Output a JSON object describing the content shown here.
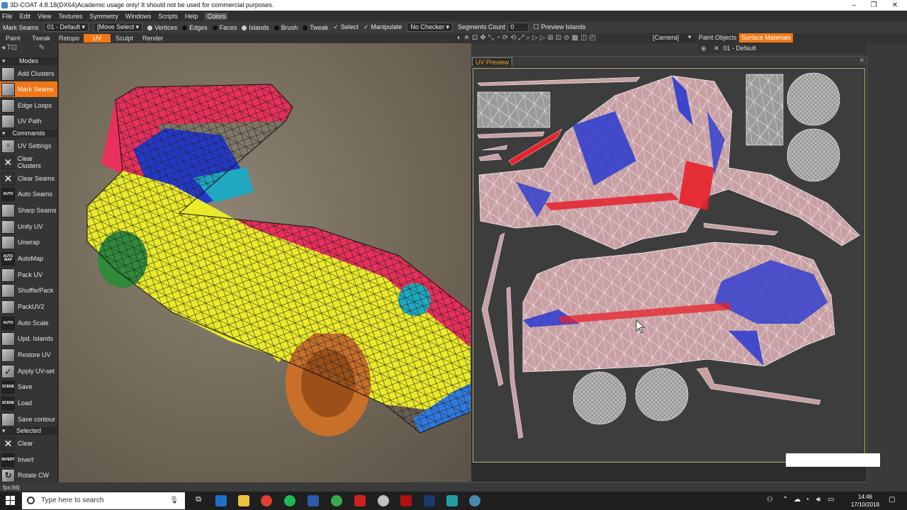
{
  "window": {
    "title": "3D-COAT 4.8.18(DX64)Academic usage only! It should not be used for commercial purposes.",
    "minimize_icon": "minimize-icon",
    "maximize_icon": "restore-icon",
    "close_icon": "close-icon"
  },
  "menu": [
    "File",
    "Edit",
    "View",
    "Textures",
    "Symmetry",
    "Windows",
    "Scripts",
    "Help",
    "Colors"
  ],
  "toolbar": {
    "current_tool": "Mark Seams",
    "object_select": "01 - Default",
    "move_select": "[Move Select",
    "modes": [
      "Vertices",
      "Edges",
      "Faces",
      "Islands",
      "Brush",
      "Tweak"
    ],
    "select_label": "Select",
    "manipulate_label": "Manipulate",
    "checker": "No Checker",
    "segments_label": "Segments Count",
    "segments_value": "0",
    "preview_islands": "Preview Islands"
  },
  "rooms": {
    "tabs": [
      "Paint",
      "Tweak",
      "Retopo",
      "UV",
      "Sculpt",
      "Render"
    ],
    "active": "UV",
    "camera": "[Camera]",
    "right_tabs": [
      "Paint Objects",
      "Surface Materials"
    ],
    "active_right": "Surface Materials",
    "material_item": "01 - Default"
  },
  "left_panel": {
    "sections": {
      "modes": "Modes",
      "commands": "Commands",
      "selected": "Selected"
    },
    "modes": [
      {
        "label": "Add Clusters",
        "icon": "add-clusters-icon"
      },
      {
        "label": "Mark Seams",
        "icon": "mark-seams-icon",
        "active": true
      },
      {
        "label": "Edge Loops",
        "icon": "edge-loops-icon"
      },
      {
        "label": "UV Path",
        "icon": "uv-path-icon"
      }
    ],
    "commands": [
      {
        "label": "UV Settings",
        "icon": "settings-icon"
      },
      {
        "label": "Clear Clusters",
        "icon": "x-icon"
      },
      {
        "label": "Clear Seams",
        "icon": "x-icon"
      },
      {
        "label": "Auto Seams",
        "icon_text": "AUTO"
      },
      {
        "label": "Sharp Seams",
        "icon": "sharp-seams-icon"
      },
      {
        "label": "Unify UV",
        "icon": "unify-uv-icon"
      },
      {
        "label": "Unwrap",
        "icon": "unwrap-icon"
      },
      {
        "label": "AutoMap",
        "icon_text": "AUTO MAP"
      },
      {
        "label": "Pack UV",
        "icon": "pack-uv-icon"
      },
      {
        "label": "Shuffle/Pack",
        "icon": "shuffle-icon"
      },
      {
        "label": "PackUV2",
        "icon": "pack-uv2-icon"
      },
      {
        "label": "Auto Scale",
        "icon_text": "AUTO"
      },
      {
        "label": "Upd. Islands",
        "icon": "update-islands-icon"
      },
      {
        "label": "Restore UV",
        "icon": "restore-icon"
      },
      {
        "label": "Apply UV-set",
        "icon": "check-icon"
      },
      {
        "label": "Save",
        "icon_text": "SCENE"
      },
      {
        "label": "Load",
        "icon_text": "SCENE"
      },
      {
        "label": "Save contour",
        "icon": "contour-icon"
      }
    ],
    "selected": [
      {
        "label": "Clear",
        "icon": "x-icon"
      },
      {
        "label": "Invert",
        "icon_text": "INVERT"
      },
      {
        "label": "Rotate CW",
        "icon": "rotate-icon"
      }
    ]
  },
  "uv_preview": {
    "tab": "UV Preview"
  },
  "status": {
    "fps": "fps:66|"
  },
  "taskbar": {
    "search_placeholder": "Type here to search",
    "time": "14:46",
    "date": "17/10/2018"
  },
  "colors": {
    "accent": "#f07818",
    "car_body_red": "#e8305a",
    "car_body_yellow": "#eaea2a",
    "uv_fill": "#c8a0a4"
  }
}
